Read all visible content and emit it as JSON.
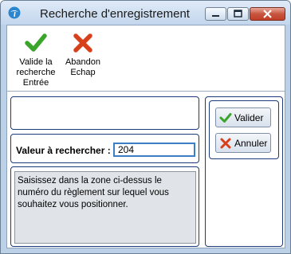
{
  "window": {
    "title": "Recherche d'enregistrement",
    "app_icon": "palm-tree-icon"
  },
  "toolbar": {
    "validate": {
      "label_lines": [
        "Valide la",
        "recherche",
        "Entrée"
      ],
      "icon": "checkmark-icon"
    },
    "cancel": {
      "label_lines": [
        "Abandon",
        "Echap"
      ],
      "icon": "x-icon"
    }
  },
  "search": {
    "label": "Valeur à rechercher :",
    "value": "204"
  },
  "message": {
    "text": "Saisissez dans la zone ci-dessus le numéro du règlement sur lequel vous souhaitez vous positionner."
  },
  "actions": {
    "validate_label": "Valider",
    "cancel_label": "Annuler"
  },
  "colors": {
    "check_green": "#3aa52a",
    "cancel_red": "#d8401c",
    "panel_border": "#1d3a7a"
  }
}
